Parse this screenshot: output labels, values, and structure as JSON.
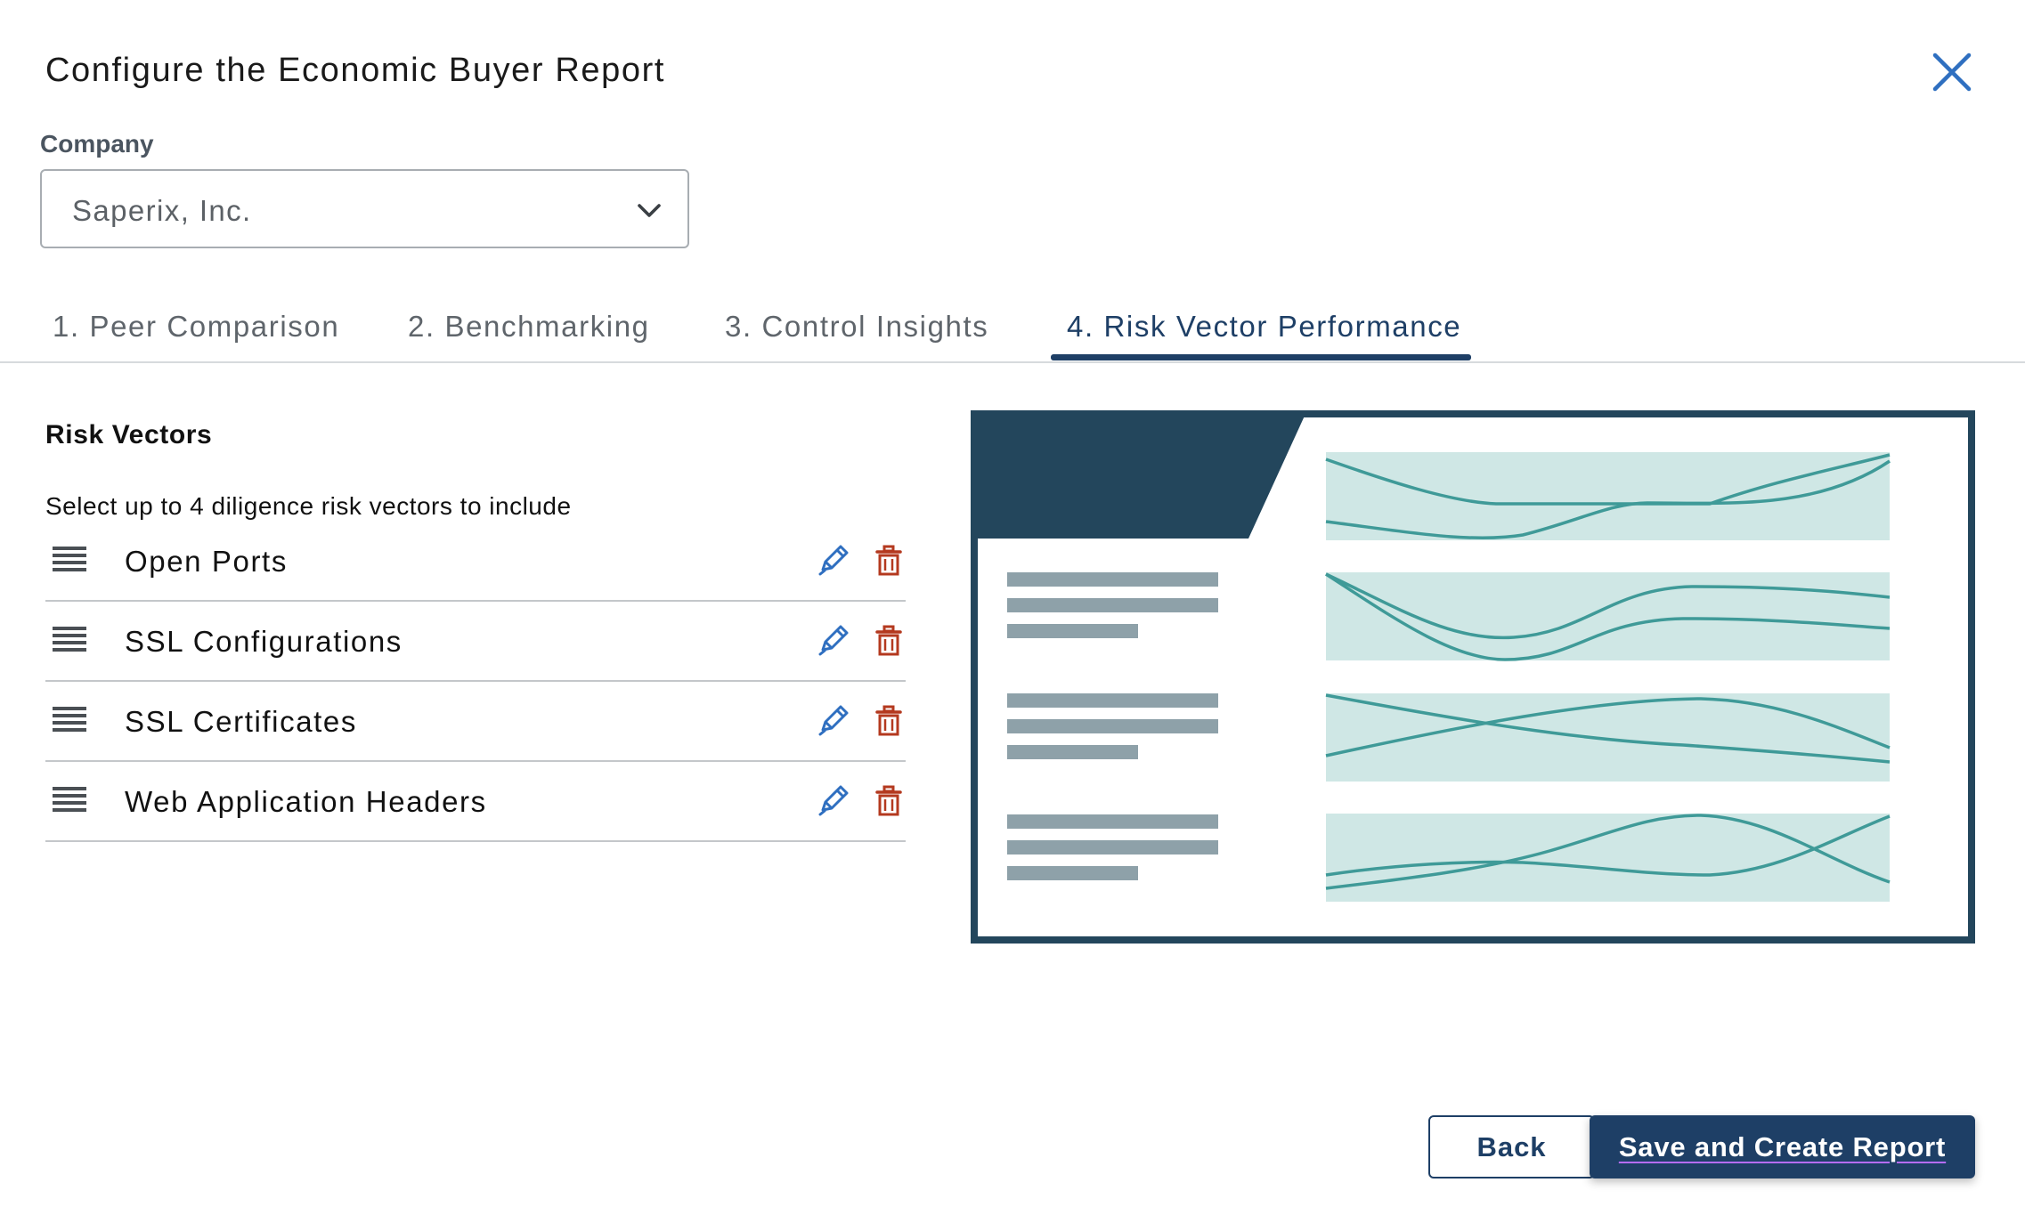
{
  "dialog": {
    "title": "Configure the Economic Buyer Report"
  },
  "company": {
    "label": "Company",
    "selected": "Saperix, Inc."
  },
  "tabs": [
    {
      "label": "1. Peer Comparison",
      "active": false
    },
    {
      "label": "2. Benchmarking",
      "active": false
    },
    {
      "label": "3. Control Insights",
      "active": false
    },
    {
      "label": "4. Risk Vector Performance",
      "active": true
    }
  ],
  "risk_vectors": {
    "title": "Risk Vectors",
    "hint": "Select up to 4 diligence risk vectors to include",
    "items": [
      {
        "label": "Open Ports"
      },
      {
        "label": "SSL Configurations"
      },
      {
        "label": "SSL Certificates"
      },
      {
        "label": "Web Application Headers"
      }
    ]
  },
  "footer": {
    "back_label": "Back",
    "primary_label": "Save and Create Report"
  },
  "colors": {
    "accent": "#1e3f66",
    "delete": "#b4391f",
    "edit": "#2f6fc0",
    "preview_frame": "#23465c",
    "preview_band": "#cfe7e5",
    "preview_line": "#3f9a98",
    "preview_text_bar": "#8ea1a9"
  },
  "icons": {
    "close": "close-icon",
    "chevron": "chevron-down-icon",
    "drag": "drag-handle-icon",
    "edit": "pencil-icon",
    "delete": "trash-icon"
  }
}
